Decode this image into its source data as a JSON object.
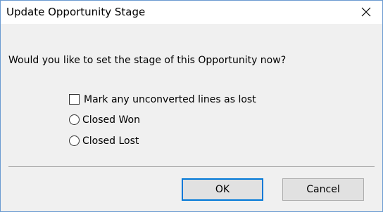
{
  "window": {
    "title": "Update Opportunity Stage",
    "close_icon": "close-icon"
  },
  "dialog": {
    "prompt": "Would you like to set the stage of this Opportunity now?",
    "checkbox": {
      "label": "Mark any unconverted lines as lost",
      "checked": false
    },
    "radios": [
      {
        "label": "Closed Won",
        "selected": false
      },
      {
        "label": "Closed Lost",
        "selected": false
      }
    ]
  },
  "buttons": {
    "ok_label": "OK",
    "cancel_label": "Cancel"
  },
  "colors": {
    "window_border": "#6b9bd1",
    "body_bg": "#f0f0f0",
    "default_button_border": "#0078d7"
  }
}
